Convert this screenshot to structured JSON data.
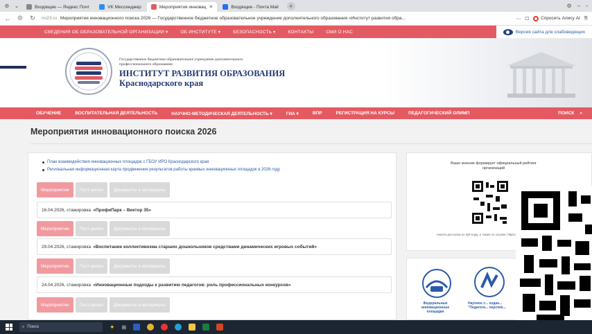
{
  "browser": {
    "tabs": [
      {
        "label": "Входящие — Яндекс Почт",
        "color": "#888888",
        "active": false
      },
      {
        "label": "VK Мессенджер",
        "color": "#2b8cf7",
        "active": false
      },
      {
        "label": "Мероприятия инновац",
        "color": "#e45a62",
        "active": true
      },
      {
        "label": "Входящие - Почта Mail",
        "color": "#2b6cf0",
        "active": false
      }
    ],
    "url_domain": "iro23.ru",
    "url_title": "Мероприятия инновационного поиска 2026 — Государственное бюджетное образовательное учреждение дополнительного образования «Институт развития обра...",
    "alice_label": "Спросить Алису AI"
  },
  "site": {
    "top_menu": [
      "СВЕДЕНИЯ ОБ ОБРАЗОВАТЕЛЬНОЙ ОРГАНИЗАЦИИ ▾",
      "ОБ ИНСТИТУТЕ ▾",
      "БЕЗОПАСНОСТЬ ▾",
      "КОНТАКТЫ",
      "СМИ О НАС"
    ],
    "vision_label": "Версия сайта для слабовидящих",
    "org_small": "Государственное бюджетное образовательное учреждение дополнительного профессионального образования",
    "org_name_line1": "ИНСТИТУТ РАЗВИТИЯ ОБРАЗОВАНИЯ",
    "org_name_line2": "Краснодарского края",
    "main_menu": [
      "ОБУЧЕНИЕ",
      "ВОСПИТАТЕЛЬНАЯ ДЕЯТЕЛЬНОСТЬ",
      "НАУЧНО-МЕТОДИЧЕСКАЯ ДЕЯТЕЛЬНОСТЬ ▾",
      "ГИА ▾",
      "ВПР",
      "РЕГИСТРАЦИЯ НА КУРСЫ",
      "ПЕДАГОГИЧЕСКИЙ ОЛИМП"
    ],
    "search_label": "ПОИСК"
  },
  "page": {
    "title": "Мероприятия инновационного поиска 2026",
    "links": [
      "План взаимодействия инновационных площадок с ГБОУ ИРО Краснодарского края",
      "Региональная информационная карта продвижения результатов работы краевых инновационных площадок в 2026 году"
    ],
    "tab_labels": [
      "Мероприятие",
      "Пост-релиз",
      "Документы и материалы"
    ],
    "events": [
      {
        "prefix": "16.04.2026, стажировка",
        "name": "«ПрофиПарк – Вектор 35»"
      },
      {
        "prefix": "29.04.2026, стажировка",
        "name": "«Воспитание коллективизма старших дошкольников средствами динамических игровых событий»"
      },
      {
        "prefix": "24.04.2026, стажировка",
        "name": "«Инновационные подходы к развитию педагогов: роль профессиональных конкурсов»"
      }
    ]
  },
  "sidebar": {
    "qr_heading": "Ваше мнение формирует официальный рейтинг организаций",
    "qr_caption": "Анкета доступна по QR-коду, а также по ссылке: https://bus.gov.ru/qrcode/...",
    "fip_label": "Федеральные инновационные площадки",
    "nm_label": "Научное с... издан... \"Педагоги... перспек..."
  },
  "taskbar": {
    "search_placeholder": "Поиск"
  },
  "colors": {
    "brand_red": "#e45a62",
    "brand_navy": "#243a73",
    "tab_pink": "#f09aa0"
  }
}
